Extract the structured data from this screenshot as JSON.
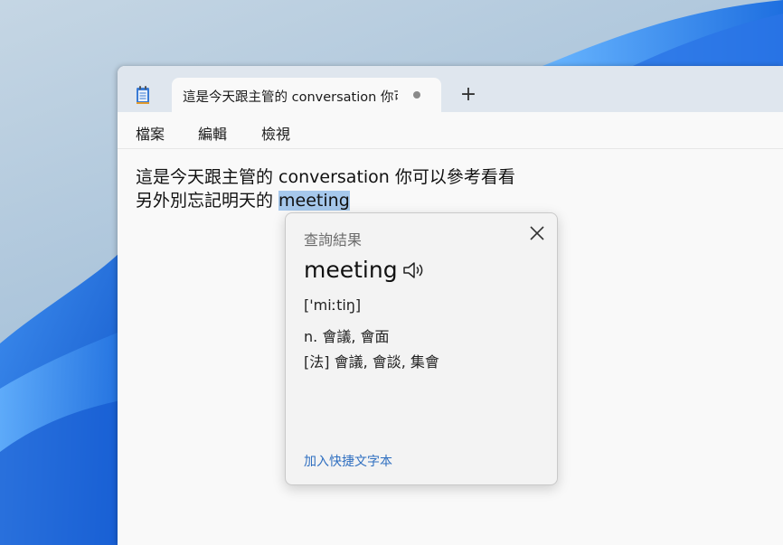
{
  "window": {
    "tab_title": "這是今天跟主管的 conversation 你可",
    "new_tab_symbol": "+"
  },
  "menu": {
    "file": "檔案",
    "edit": "編輯",
    "view": "檢視"
  },
  "editor": {
    "line1": "這是今天跟主管的 conversation 你可以參考看看",
    "line2_prefix": "另外別忘記明天的 ",
    "line2_selected": "meeting"
  },
  "lookup_popup": {
    "title": "查詢結果",
    "word": "meeting",
    "phonetic": "['miːtiŋ]",
    "definitions": [
      "n. 會議, 會面",
      "[法] 會議, 會談, 集會"
    ],
    "add_link": "加入快捷文字本"
  },
  "icons": {
    "app": "notepad-icon",
    "close": "close-icon",
    "speaker": "speaker-icon",
    "tab_status": "unsaved-dot-icon"
  },
  "colors": {
    "selection": "#a6c8ec",
    "link": "#2f6fc0",
    "titlebar": "#dfe6ee"
  }
}
